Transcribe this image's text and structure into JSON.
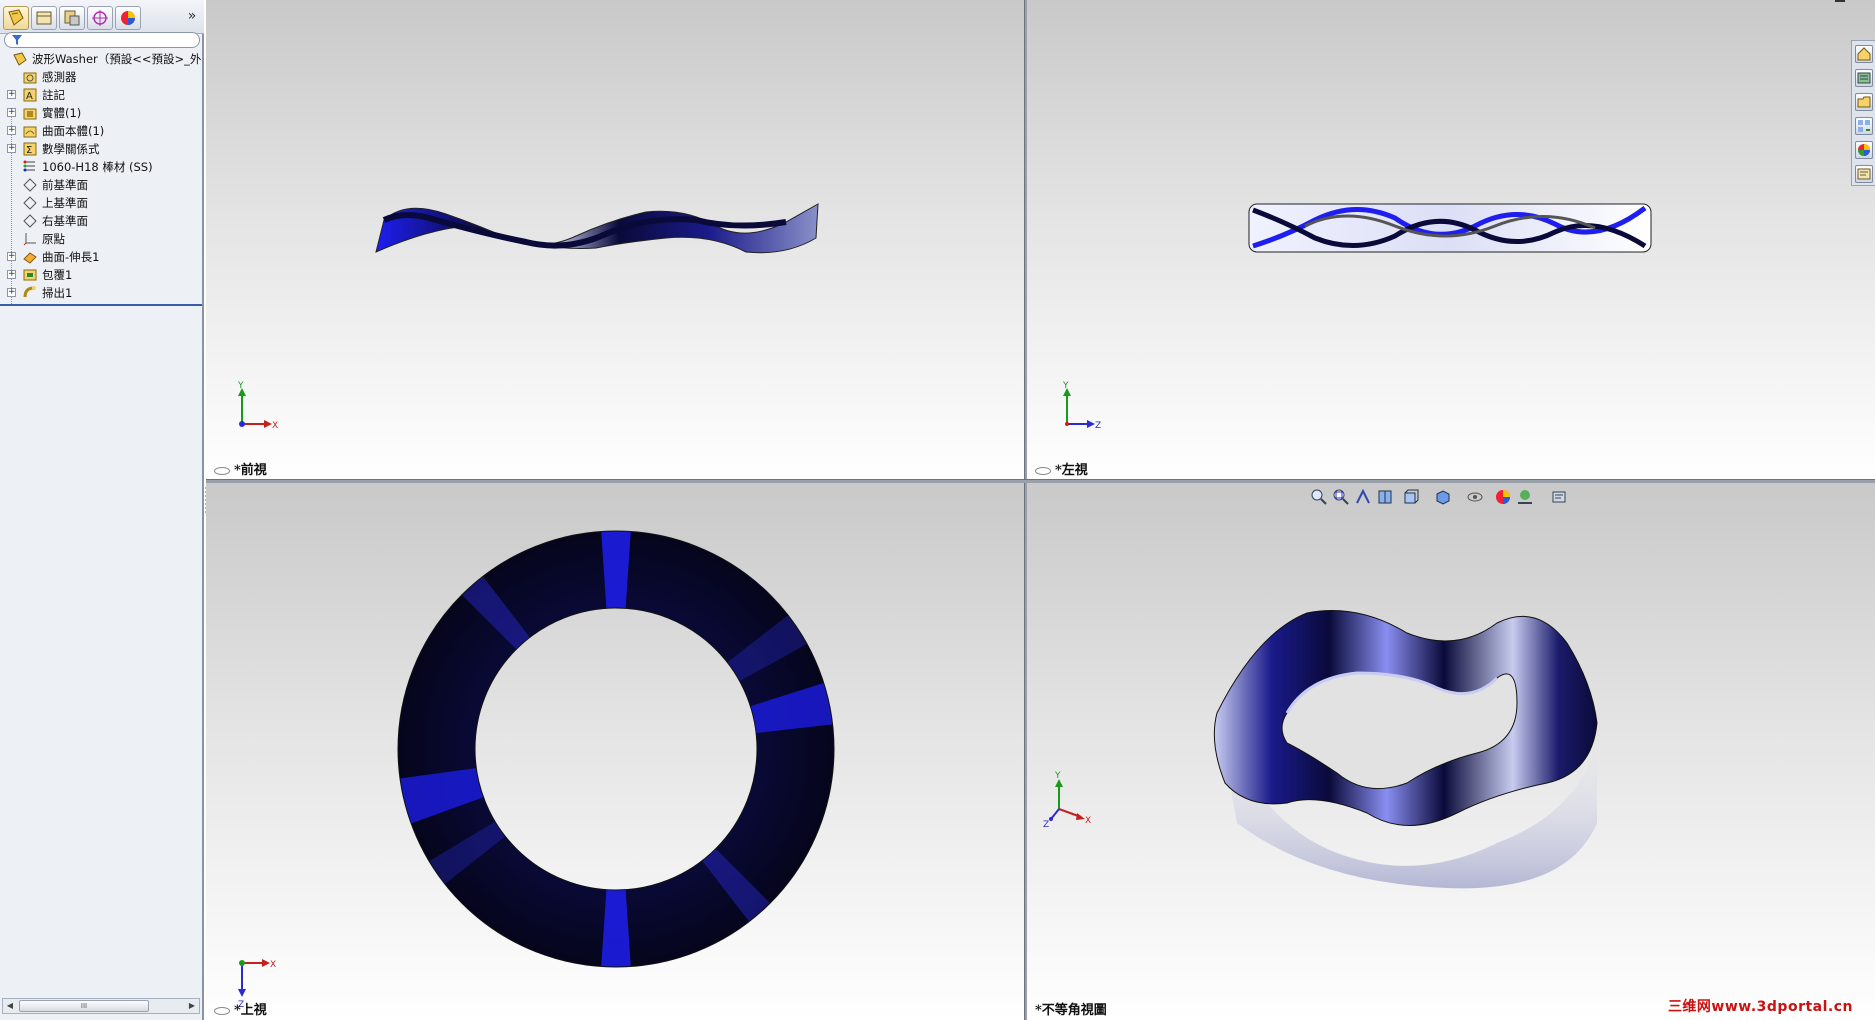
{
  "feature_manager": {
    "tabs": [
      {
        "name": "featuremanager-tree-icon"
      },
      {
        "name": "propertymanager-icon"
      },
      {
        "name": "configurationmanager-icon"
      },
      {
        "name": "dimxpert-icon"
      },
      {
        "name": "display-manager-icon"
      }
    ],
    "expand_label": "»",
    "tree": [
      {
        "label": "波形Washer（預設<<預設>_外觀",
        "icon": "part-icon",
        "expandable": false
      },
      {
        "label": "感測器",
        "icon": "sensors-folder-icon",
        "expandable": false
      },
      {
        "label": "註記",
        "icon": "annotations-icon",
        "expandable": true
      },
      {
        "label": "實體(1)",
        "icon": "solid-bodies-folder-icon",
        "expandable": true
      },
      {
        "label": "曲面本體(1)",
        "icon": "surface-bodies-folder-icon",
        "expandable": true
      },
      {
        "label": "數學關係式",
        "icon": "equations-icon",
        "expandable": true
      },
      {
        "label": "1060-H18 棒材 (SS)",
        "icon": "material-icon",
        "expandable": false
      },
      {
        "label": "前基準面",
        "icon": "plane-icon",
        "expandable": false
      },
      {
        "label": "上基準面",
        "icon": "plane-icon",
        "expandable": false
      },
      {
        "label": "右基準面",
        "icon": "plane-icon",
        "expandable": false
      },
      {
        "label": "原點",
        "icon": "origin-icon",
        "expandable": false
      },
      {
        "label": "曲面-伸長1",
        "icon": "surface-extrude-icon",
        "expandable": true
      },
      {
        "label": "包覆1",
        "icon": "wrap-feature-icon",
        "expandable": true
      },
      {
        "label": "掃出1",
        "icon": "sweep-feature-icon",
        "expandable": true
      }
    ],
    "scrollbar_grip": "III"
  },
  "viewports": {
    "front": {
      "label": "*前視",
      "axis_a": "Y",
      "axis_b": "X"
    },
    "left": {
      "label": "*左視",
      "axis_a": "Y",
      "axis_b": "Z"
    },
    "top": {
      "label": "*上視",
      "axis_a": "X",
      "axis_b": "Z"
    },
    "iso": {
      "label": "*不等角視圖",
      "axis_a": "Y",
      "axis_b": "X",
      "axis_c": "Z"
    }
  },
  "heads_up_toolbar": [
    "zoom-to-fit-icon",
    "zoom-to-area-icon",
    "previous-view-icon",
    "section-view-icon",
    "view-orientation-icon",
    "display-style-icon",
    "hide-show-items-icon",
    "edit-appearance-icon",
    "apply-scene-icon",
    "view-settings-icon"
  ],
  "task_pane": [
    "solidworks-resources-icon",
    "design-library-icon",
    "file-explorer-icon",
    "view-palette-icon",
    "appearances-scenes-icon",
    "custom-properties-icon"
  ],
  "colors": {
    "model_dark": "#0a0a3a",
    "model_blue": "#1e1ef0",
    "model_light": "#c8ccf0",
    "viewport_top": "#c9c9c9",
    "viewport_bottom": "#ffffff"
  },
  "watermark": "三维网www.3dportal.cn"
}
